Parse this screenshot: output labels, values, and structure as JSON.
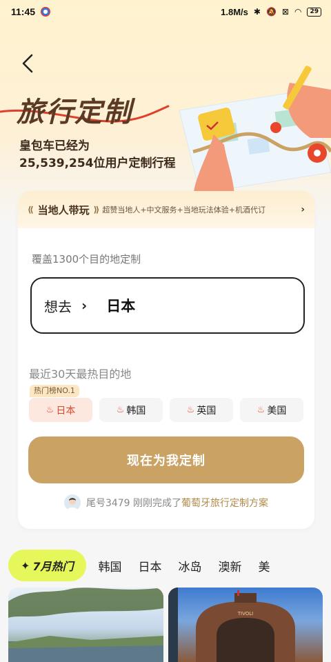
{
  "status_bar": {
    "time": "11:45",
    "speed": "1.8M/s",
    "battery": "29"
  },
  "hero": {
    "title": "旅行定制",
    "subtitle_line1": "皇包车已经为",
    "subtitle_line2": "25,539,254位用户定制行程"
  },
  "local_guide": {
    "title": "当地人带玩",
    "description": "超赞当地人+中文服务+当地玩法体验+机酒代订"
  },
  "planner": {
    "coverage": "覆盖1300个目的地定制",
    "want_label": "想去",
    "destination": "日本",
    "hot_label": "最近30天最热目的地",
    "rank_tag": "热门榜NO.1",
    "hot_destinations": [
      {
        "label": "日本",
        "active": true
      },
      {
        "label": "韩国",
        "active": false
      },
      {
        "label": "英国",
        "active": false
      },
      {
        "label": "美国",
        "active": false
      }
    ],
    "cta_label": "现在为我定制",
    "recent_prefix": "尾号3479 刚刚完成了",
    "recent_link": "葡萄牙旅行定制方案"
  },
  "tabs": {
    "active": "7月热门",
    "items": [
      "韩国",
      "日本",
      "冰岛",
      "澳新",
      "美"
    ]
  },
  "colors": {
    "accent_gold": "#c9a264",
    "tab_active": "#e6f75b",
    "hot_red": "#e0482a"
  }
}
